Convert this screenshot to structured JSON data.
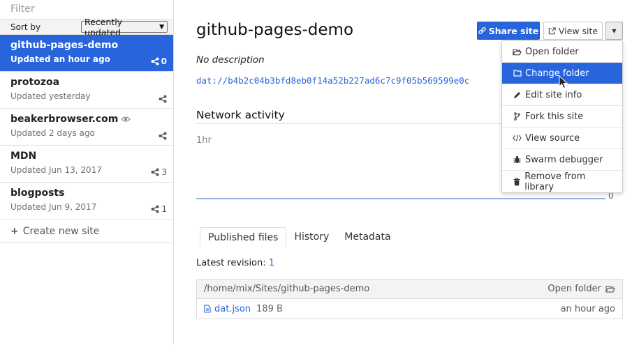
{
  "sidebar": {
    "filter_placeholder": "Filter",
    "sort_label": "Sort by",
    "sort_value": "Recently updated",
    "create_new": "Create new site",
    "sites": [
      {
        "title": "github-pages-demo",
        "updated": "Updated an hour ago",
        "peers": "0",
        "active": true
      },
      {
        "title": "protozoa",
        "updated": "Updated yesterday",
        "peers": ""
      },
      {
        "title": "beakerbrowser.com",
        "updated": "Updated 2 days ago",
        "peers": "",
        "watched": true
      },
      {
        "title": "MDN",
        "updated": "Updated Jun 13, 2017",
        "peers": "3"
      },
      {
        "title": "blogposts",
        "updated": "Updated Jun 9, 2017",
        "peers": "1"
      }
    ]
  },
  "main": {
    "title": "github-pages-demo",
    "share_label": "Share site",
    "view_label": "View site",
    "description": "No description",
    "dat_url": "dat://b4b2c04b3bfd8eb0f14a52b227ad6c7c9f05b569599e0c",
    "network_title": "Network activity",
    "time_range": "1hr",
    "graph_value": "0",
    "tabs": [
      "Published files",
      "History",
      "Metadata"
    ],
    "latest_label": "Latest revision:",
    "latest_rev": "1",
    "files": {
      "path": "/home/mix/Sites/github-pages-demo",
      "open_folder": "Open folder",
      "rows": [
        {
          "name": "dat.json",
          "size": "189 B",
          "time": "an hour ago"
        }
      ]
    }
  },
  "dropdown": {
    "items": [
      {
        "label": "Open folder",
        "icon": "folder-open-icon"
      },
      {
        "label": "Change folder",
        "icon": "folder-icon",
        "active": true
      },
      {
        "label": "Edit site info",
        "icon": "pencil-icon"
      },
      {
        "label": "Fork this site",
        "icon": "code-fork-icon"
      },
      {
        "label": "View source",
        "icon": "code-icon"
      },
      {
        "label": "Swarm debugger",
        "icon": "bug-icon"
      },
      {
        "label": "Remove from library",
        "icon": "trash-icon"
      }
    ]
  },
  "colors": {
    "accent": "#2864dc",
    "graph": "#90b8e6"
  }
}
